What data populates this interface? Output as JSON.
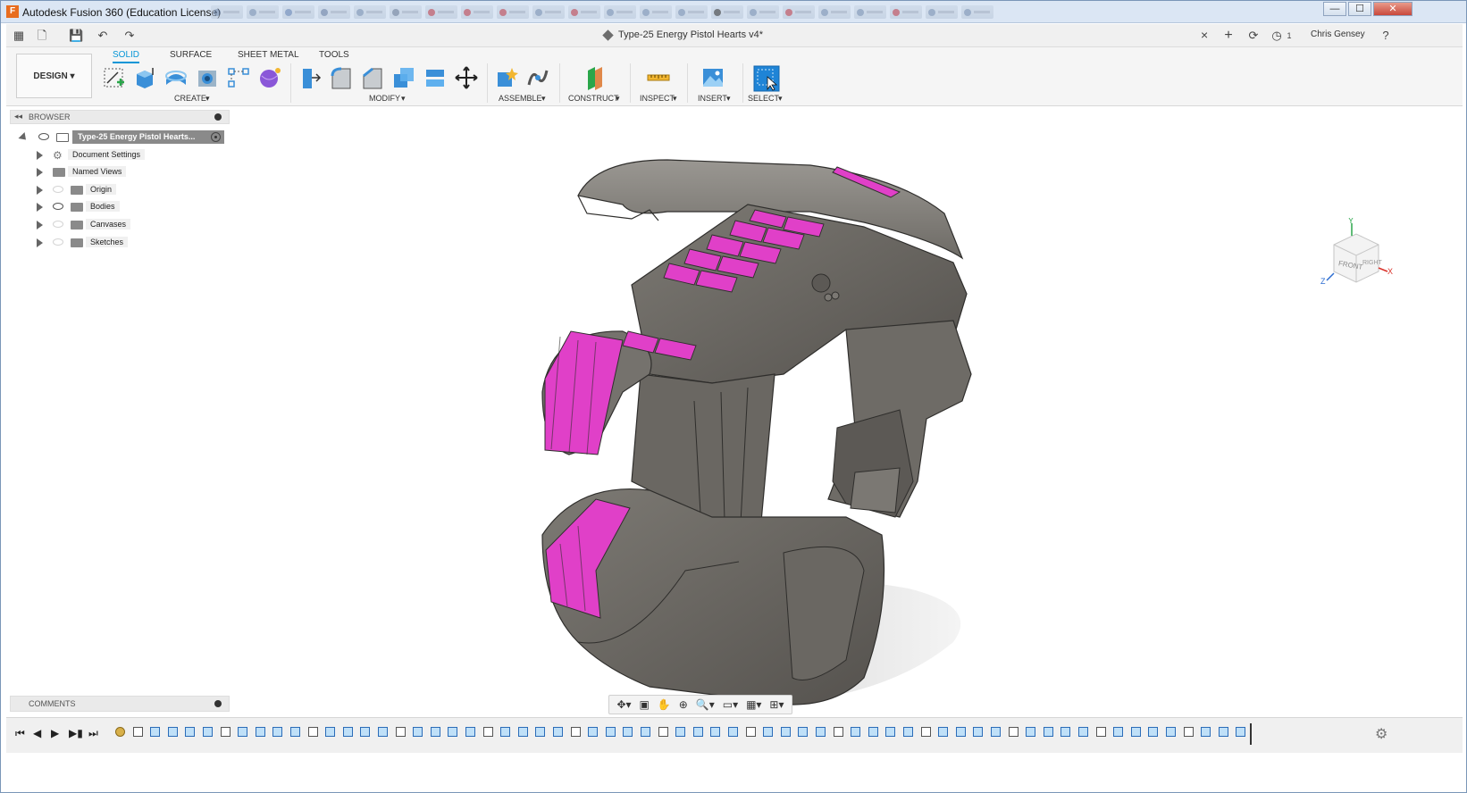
{
  "window": {
    "title": "Autodesk Fusion 360 (Education License)",
    "controls": [
      "minimize",
      "maximize",
      "close"
    ]
  },
  "appbar": {
    "document_title": "Type-25 Energy Pistol Hearts v4*",
    "close_symbol": "×",
    "notification_count": "1",
    "user_name": "Chris Gensey",
    "help_symbol": "?"
  },
  "ribbon": {
    "workspace": "DESIGN",
    "tabs": [
      "SOLID",
      "SURFACE",
      "SHEET METAL",
      "TOOLS"
    ],
    "active_tab": "SOLID",
    "groups": [
      "CREATE",
      "MODIFY",
      "ASSEMBLE",
      "CONSTRUCT",
      "INSPECT",
      "INSERT",
      "SELECT"
    ]
  },
  "browser": {
    "header": "BROWSER",
    "root": "Type-25 Energy Pistol Hearts...",
    "items": [
      {
        "label": "Document Settings",
        "icon": "gear-icon",
        "visible": null
      },
      {
        "label": "Named Views",
        "icon": "folder-icon",
        "visible": null
      },
      {
        "label": "Origin",
        "icon": "folder-icon",
        "visible": false
      },
      {
        "label": "Bodies",
        "icon": "folder-icon",
        "visible": true
      },
      {
        "label": "Canvases",
        "icon": "folder-icon",
        "visible": false
      },
      {
        "label": "Sketches",
        "icon": "folder-icon",
        "visible": false
      }
    ]
  },
  "viewcube": {
    "face_front": "FRONT",
    "face_right": "RIGHT",
    "axis_x": "X",
    "axis_y": "Y",
    "axis_z": "Z"
  },
  "comments": {
    "header": "COMMENTS"
  },
  "colors": {
    "accent": "#0696d7",
    "model_body": "#6e6b66",
    "model_accent": "#e040c8"
  }
}
